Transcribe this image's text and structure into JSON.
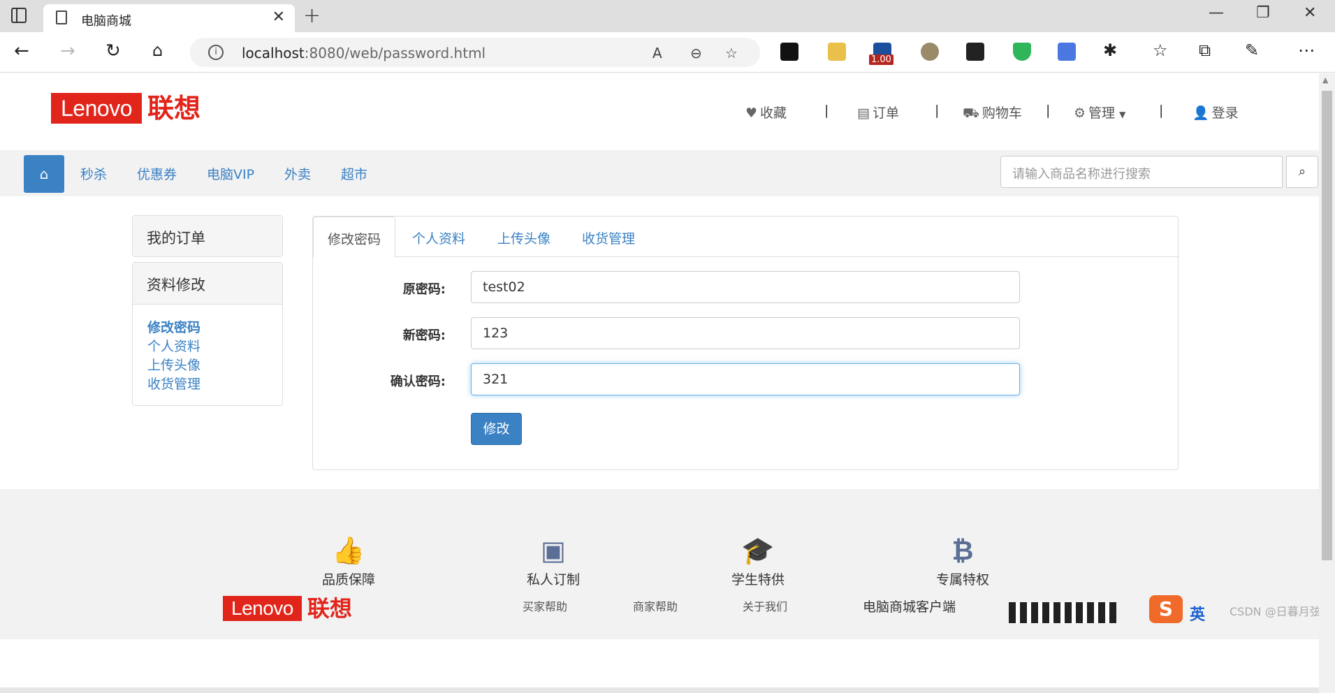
{
  "browser": {
    "tab_title": "电脑商城",
    "tab_close": "✕",
    "new_tab": "+",
    "url_host": "localhost",
    "url_rest": ":8080/web/password.html",
    "ext_badge": "1.00",
    "window_controls": {
      "minimize": "—",
      "restore": "❐",
      "close": "✕"
    }
  },
  "header": {
    "logo_text": "Lenovo",
    "logo_cn": "联想",
    "links": [
      {
        "icon": "heart-icon",
        "label": "收藏"
      },
      {
        "icon": "file-icon",
        "label": "订单"
      },
      {
        "icon": "cart-icon",
        "label": "购物车"
      },
      {
        "icon": "gears-icon",
        "label": "管理"
      },
      {
        "icon": "user-icon",
        "label": "登录"
      }
    ],
    "separator": "|"
  },
  "navbar": {
    "items": [
      "秒杀",
      "优惠券",
      "电脑VIP",
      "外卖",
      "超市"
    ],
    "search_placeholder": "请输入商品名称进行搜索"
  },
  "sidebar": {
    "orders_title": "我的订单",
    "profile_title": "资料修改",
    "links": [
      "修改密码",
      "个人资料",
      "上传头像",
      "收货管理"
    ],
    "active_index": 0
  },
  "tabs": [
    "修改密码",
    "个人资料",
    "上传头像",
    "收货管理"
  ],
  "form": {
    "old_label": "原密码:",
    "old_value": "test02",
    "new_label": "新密码:",
    "new_value": "123",
    "confirm_label": "确认密码:",
    "confirm_value": "321",
    "submit_label": "修改"
  },
  "features": [
    {
      "icon": "thumbs-up-icon",
      "label": "品质保障"
    },
    {
      "icon": "id-card-icon",
      "label": "私人订制"
    },
    {
      "icon": "graduation-cap-icon",
      "label": "学生特供"
    },
    {
      "icon": "bitcoin-icon",
      "label": "专属特权"
    }
  ],
  "footer": {
    "logo_text": "Lenovo",
    "logo_cn": "联想",
    "links": [
      "买家帮助",
      "商家帮助",
      "关于我们"
    ],
    "client_label": "电脑商城客户端"
  },
  "system": {
    "ime_icon": "S",
    "ime_lang": "英",
    "watermark": "CSDN @日暮月弦"
  },
  "colors": {
    "brand_red": "#e1251b",
    "link_blue": "#3b82c4",
    "feature_icon": "#5b6f96"
  }
}
